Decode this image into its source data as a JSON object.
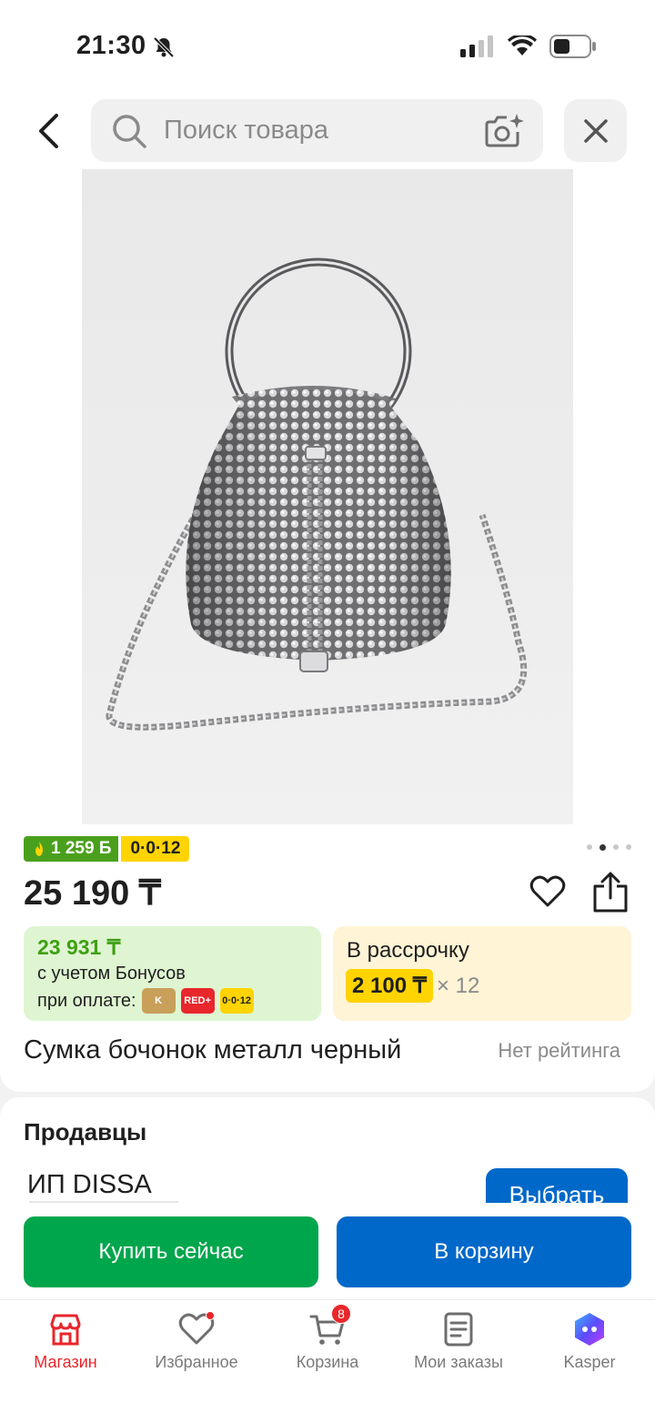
{
  "status_bar": {
    "time": "21:30"
  },
  "search": {
    "placeholder": "Поиск товара"
  },
  "product": {
    "bonus_badge": "1 259 Б",
    "installment_badge": "0·0·12",
    "price": "25 190 ₸",
    "bonus_price": "23 931 ₸",
    "bonus_note": "с учетом Бонусов",
    "pay_label": "при оплате:",
    "pay_logos": [
      "K",
      "RED+",
      "0·0·12"
    ],
    "installment_title": "В рассрочку",
    "installment_amount": "2 100 ₸",
    "installment_months": "× 12",
    "title": "Сумка бочонок металл черный",
    "rating": "Нет рейтинга",
    "image_count": 4,
    "image_index": 1
  },
  "sellers": {
    "title": "Продавцы",
    "seller_name": "ИП DISSA",
    "choose_label": "Выбрать"
  },
  "actions": {
    "buy_now": "Купить сейчас",
    "add_to_cart": "В корзину"
  },
  "nav": {
    "items": [
      {
        "label": "Магазин",
        "icon": "shop-icon",
        "active": true
      },
      {
        "label": "Избранное",
        "icon": "heart-icon"
      },
      {
        "label": "Корзина",
        "icon": "cart-icon",
        "badge": "8"
      },
      {
        "label": "Мои заказы",
        "icon": "orders-icon"
      },
      {
        "label": "Kasper",
        "icon": "kasper-icon"
      }
    ]
  },
  "colors": {
    "brand_red": "#e8262b",
    "buy_green": "#00a64c",
    "cart_blue": "#0068c9",
    "bonus_green": "#4aa01c",
    "installment_yellow": "#ffd400"
  }
}
